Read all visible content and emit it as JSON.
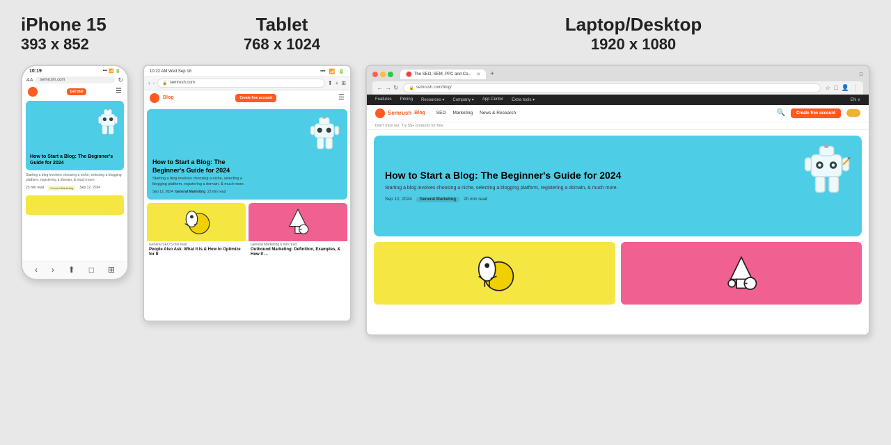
{
  "labels": {
    "iphone": {
      "name": "iPhone 15",
      "dims": "393 x 852"
    },
    "tablet": {
      "name": "Tablet",
      "dims": "768 x 1024"
    },
    "desktop": {
      "name": "Laptop/Desktop",
      "dims": "1920 x 1080"
    }
  },
  "iphone": {
    "time": "10:19",
    "url": "semrush.com",
    "hero_title": "How to Start a Blog: The Beginner's Guide for 2024",
    "hero_desc": "Starting a blog involves choosing a niche, selecting a blogging platform, registering a domain, & much more.",
    "meta_time": "23 min read",
    "meta_cat": "General Marketing",
    "meta_date": "Sep 12, 2024",
    "get_trial": "Get trial"
  },
  "tablet": {
    "time": "10:22 AM Wed Sep 18",
    "url": "semrush.com",
    "hero_title": "How to Start a Blog: The Beginner's Guide for 2024",
    "hero_desc": "Starting a blog involves choosing a niche, selecting a blogging platform, registering a domain, & much more.",
    "meta": "Sep 12, 2024",
    "meta_cat": "General Marketing",
    "meta_time": "23 min read",
    "cta": "Create free account",
    "card1_cat": "General SEO  5 min read",
    "card1_title": "People Also Ask: What It Is & How to Optimize for It",
    "card2_cat": "General Marketing  6 min read",
    "card2_title": "Outbound Marketing: Definition, Examples, & How It ..."
  },
  "desktop": {
    "tab_title": "The SEO, SEM, PPC and Co...",
    "url": "semrush.com/blog/",
    "nav_items": [
      "Features",
      "Pricing",
      "Resources",
      "Company",
      "App Center",
      "Extra tools"
    ],
    "lang": "EN ∨",
    "brand_nav": [
      "SEO",
      "Marketing",
      "News & Research"
    ],
    "hero_title": "How to Start a Blog: The Beginner's Guide for 2024",
    "hero_desc": "Starting a blog involves choosing a niche, selecting a blogging platform, registering a domain, & much more.",
    "hero_date": "Sep 12, 2024",
    "hero_cat": "General Marketing",
    "hero_time": "20 min read",
    "cta": "Create free account",
    "promo": "Don't miss out. Try 55+ products for free.",
    "search_placeholder": "Search"
  }
}
